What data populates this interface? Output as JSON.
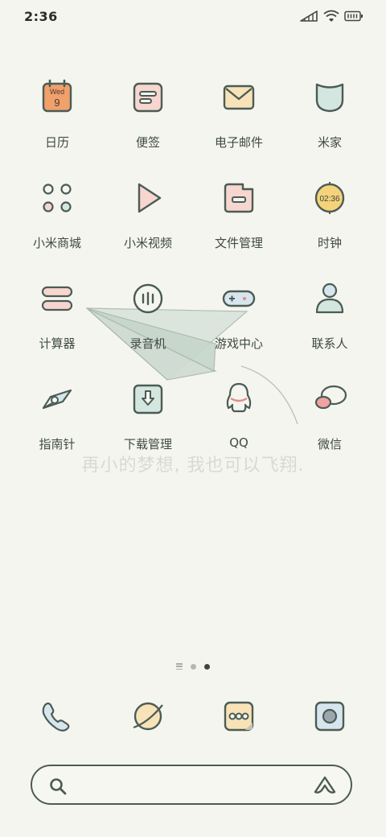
{
  "status_bar": {
    "time": "2:36",
    "icons": [
      "signal-icon",
      "wifi-icon",
      "battery-icon"
    ]
  },
  "apps": [
    {
      "label": "日历",
      "icon": "calendar-icon",
      "icon_text_top": "Wed",
      "icon_text_bottom": "9"
    },
    {
      "label": "便签",
      "icon": "notes-icon"
    },
    {
      "label": "电子邮件",
      "icon": "mail-icon"
    },
    {
      "label": "米家",
      "icon": "mijia-icon"
    },
    {
      "label": "小米商城",
      "icon": "mall-icon"
    },
    {
      "label": "小米视频",
      "icon": "video-icon"
    },
    {
      "label": "文件管理",
      "icon": "folder-icon"
    },
    {
      "label": "时钟",
      "icon": "clock-icon",
      "icon_text": "02:36"
    },
    {
      "label": "计算器",
      "icon": "calculator-icon"
    },
    {
      "label": "录音机",
      "icon": "recorder-icon"
    },
    {
      "label": "游戏中心",
      "icon": "gamepad-icon"
    },
    {
      "label": "联系人",
      "icon": "contacts-icon"
    },
    {
      "label": "指南针",
      "icon": "compass-icon"
    },
    {
      "label": "下载管理",
      "icon": "download-icon"
    },
    {
      "label": "QQ",
      "icon": "qq-icon"
    },
    {
      "label": "微信",
      "icon": "wechat-icon"
    }
  ],
  "wallpaper_quote": "再小的梦想, 我也可以飞翔.",
  "page_indicator": {
    "pages": 3,
    "current": 3
  },
  "dock": [
    {
      "icon": "phone-icon"
    },
    {
      "icon": "browser-icon"
    },
    {
      "icon": "messages-icon"
    },
    {
      "icon": "camera-icon"
    }
  ],
  "search": {
    "value": "",
    "placeholder": ""
  },
  "colors": {
    "background": "#f5f5ef",
    "outline": "#4b5c55",
    "orange": "#f0a06b",
    "pink": "#f6d6cf",
    "cream": "#f7e3b7",
    "mint": "#d3e6df",
    "yellow": "#f5d37a",
    "blue": "#d7e6ee"
  }
}
